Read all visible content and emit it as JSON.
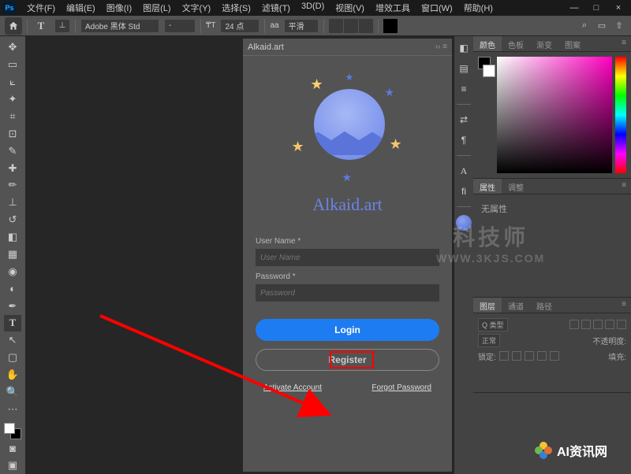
{
  "menubar": [
    "文件(F)",
    "编辑(E)",
    "图像(I)",
    "图层(L)",
    "文字(Y)",
    "选择(S)",
    "滤镜(T)",
    "3D(D)",
    "视图(V)",
    "增效工具",
    "窗口(W)",
    "帮助(H)"
  ],
  "options": {
    "font_family": "Adobe 黑体 Std",
    "font_style": "-",
    "size_label": "T",
    "font_size": "24 点",
    "aa": "aa",
    "sharp": "平滑"
  },
  "panel": {
    "title": "Alkaid.art",
    "brand": "Alkaid.art",
    "username_label": "User Name *",
    "username_placeholder": "User Name",
    "password_label": "Password *",
    "password_placeholder": "Password",
    "login": "Login",
    "register": "Register",
    "activate": "Activate Account",
    "forgot": "Forgot Password"
  },
  "right": {
    "color_tabs": [
      "颜色",
      "色板",
      "渐变",
      "图案"
    ],
    "attr_tabs": [
      "属性",
      "调整"
    ],
    "attr_empty": "无属性",
    "layer_tabs": [
      "图层",
      "通道",
      "路径"
    ],
    "layer_kind": "Q 类型",
    "layer_mode": "正常",
    "layer_opacity_label": "不透明度:",
    "layer_lock_label": "锁定:",
    "layer_fill_label": "填充:"
  },
  "watermark": {
    "text": "科技师",
    "url": "WWW.3KJS.COM",
    "brand2": "AI资讯网"
  }
}
